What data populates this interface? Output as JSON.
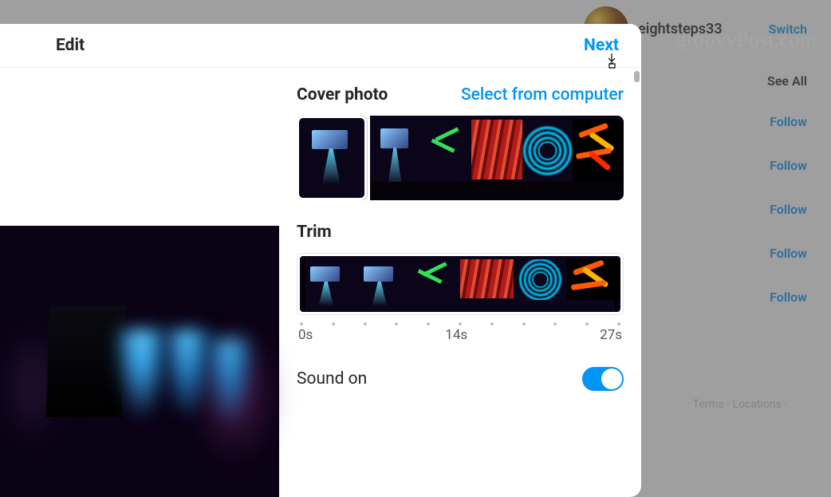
{
  "header": {
    "title": "Edit",
    "next": "Next"
  },
  "cover": {
    "title": "Cover photo",
    "select_link": "Select from computer"
  },
  "trim": {
    "title": "Trim",
    "start": "0s",
    "mid": "14s",
    "end": "27s"
  },
  "sound": {
    "label": "Sound on",
    "on": true
  },
  "background": {
    "username": "eightsteps33",
    "switch": "Switch",
    "see_all": "See All",
    "follow": "Follow",
    "footer": "· Terms · Locations ·"
  },
  "watermark": "groovyPost.com"
}
